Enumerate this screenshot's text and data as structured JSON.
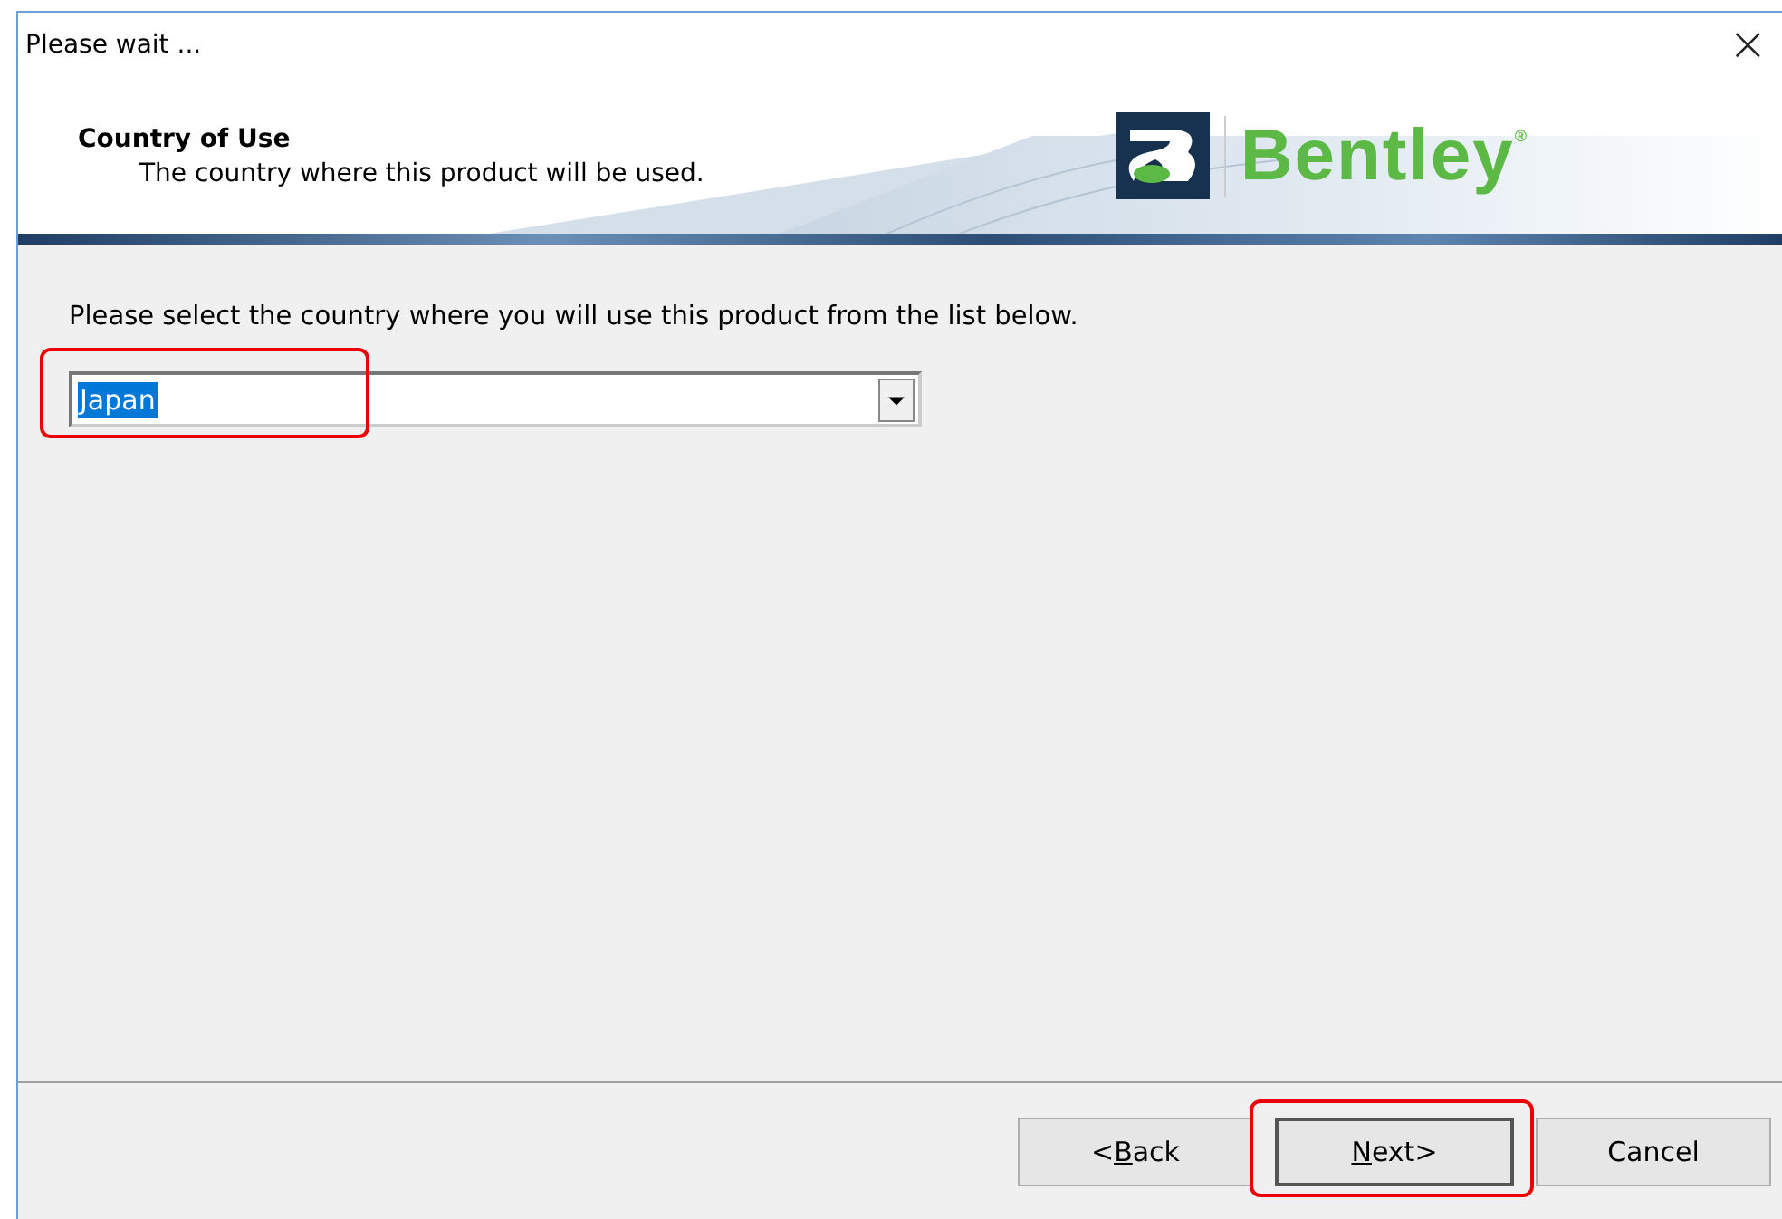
{
  "window": {
    "title": "Please wait ...",
    "close": "×"
  },
  "header": {
    "title": "Country of Use",
    "subtitle": "The country where this product will be used.",
    "logo_text": "Bentley$^{®}$"
  },
  "body": {
    "instruction": "Please select the country where you will use this product from the list below.",
    "country_field": {
      "value": "Japan",
      "highlighted": true
    }
  },
  "buttons": [
    {
      "before": "<",
      "key": "B",
      "after": "ack",
      "default": false,
      "highlighted": false
    },
    {
      "key": "N",
      "after": "ext>",
      "default": true,
      "highlighted": true
    },
    {
      "before": "Cancel",
      "default": false,
      "highlighted": false
    }
  ]
}
